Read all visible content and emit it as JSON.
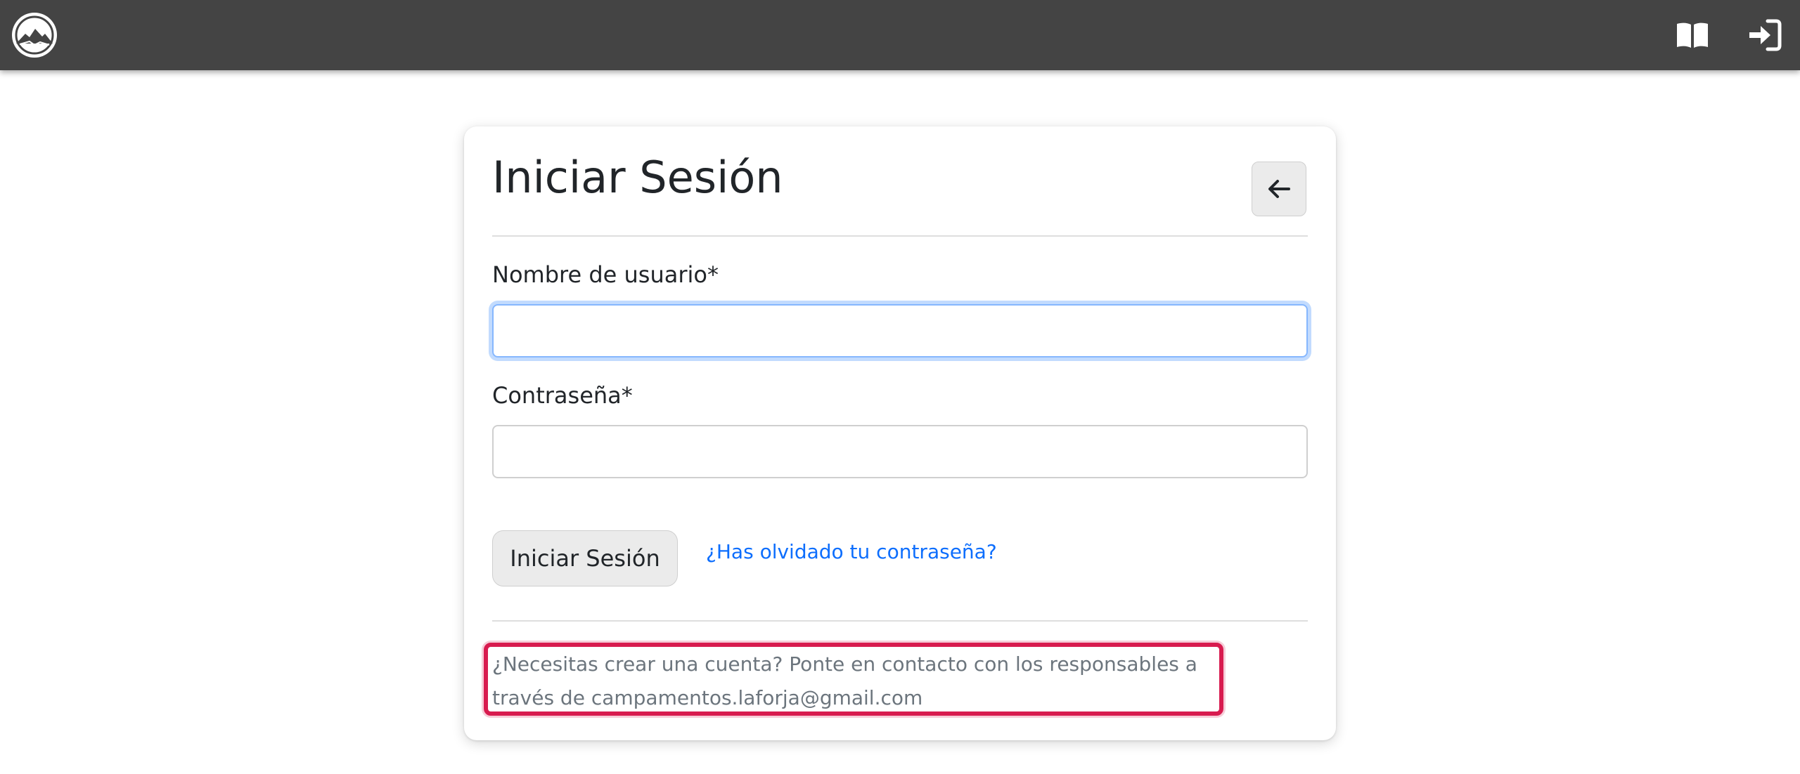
{
  "navbar": {
    "logo_icon": "mountain-logo",
    "docs_icon": "book-open-icon",
    "login_icon": "sign-in-icon",
    "background_color": "#444444"
  },
  "login": {
    "title": "Iniciar Sesión",
    "back_icon": "arrow-left-icon",
    "username_label": "Nombre de usuario*",
    "username_value": "",
    "password_label": "Contraseña*",
    "password_value": "",
    "submit_label": "Iniciar Sesión",
    "forgot_password_link": "¿Has olvidado tu contraseña?",
    "account_notice": "¿Necesitas crear una cuenta? Ponte en contacto con los responsables a través de campamentos.laforja@gmail.com"
  },
  "colors": {
    "link": "#0d6efd",
    "highlight_border": "#d81b4f",
    "focus_ring": "#86b7fe"
  }
}
